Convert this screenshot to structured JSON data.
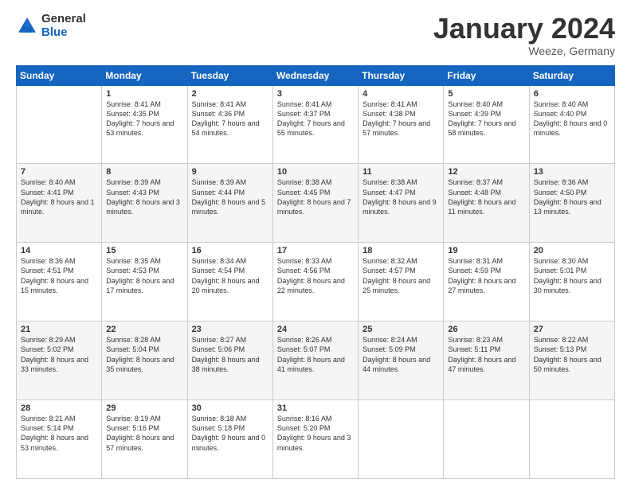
{
  "logo": {
    "general": "General",
    "blue": "Blue"
  },
  "header": {
    "month": "January 2024",
    "location": "Weeze, Germany"
  },
  "weekdays": [
    "Sunday",
    "Monday",
    "Tuesday",
    "Wednesday",
    "Thursday",
    "Friday",
    "Saturday"
  ],
  "weeks": [
    [
      {
        "day": "",
        "sunrise": "",
        "sunset": "",
        "daylight": ""
      },
      {
        "day": "1",
        "sunrise": "Sunrise: 8:41 AM",
        "sunset": "Sunset: 4:35 PM",
        "daylight": "Daylight: 7 hours and 53 minutes."
      },
      {
        "day": "2",
        "sunrise": "Sunrise: 8:41 AM",
        "sunset": "Sunset: 4:36 PM",
        "daylight": "Daylight: 7 hours and 54 minutes."
      },
      {
        "day": "3",
        "sunrise": "Sunrise: 8:41 AM",
        "sunset": "Sunset: 4:37 PM",
        "daylight": "Daylight: 7 hours and 55 minutes."
      },
      {
        "day": "4",
        "sunrise": "Sunrise: 8:41 AM",
        "sunset": "Sunset: 4:38 PM",
        "daylight": "Daylight: 7 hours and 57 minutes."
      },
      {
        "day": "5",
        "sunrise": "Sunrise: 8:40 AM",
        "sunset": "Sunset: 4:39 PM",
        "daylight": "Daylight: 7 hours and 58 minutes."
      },
      {
        "day": "6",
        "sunrise": "Sunrise: 8:40 AM",
        "sunset": "Sunset: 4:40 PM",
        "daylight": "Daylight: 8 hours and 0 minutes."
      }
    ],
    [
      {
        "day": "7",
        "sunrise": "Sunrise: 8:40 AM",
        "sunset": "Sunset: 4:41 PM",
        "daylight": "Daylight: 8 hours and 1 minute."
      },
      {
        "day": "8",
        "sunrise": "Sunrise: 8:39 AM",
        "sunset": "Sunset: 4:43 PM",
        "daylight": "Daylight: 8 hours and 3 minutes."
      },
      {
        "day": "9",
        "sunrise": "Sunrise: 8:39 AM",
        "sunset": "Sunset: 4:44 PM",
        "daylight": "Daylight: 8 hours and 5 minutes."
      },
      {
        "day": "10",
        "sunrise": "Sunrise: 8:38 AM",
        "sunset": "Sunset: 4:45 PM",
        "daylight": "Daylight: 8 hours and 7 minutes."
      },
      {
        "day": "11",
        "sunrise": "Sunrise: 8:38 AM",
        "sunset": "Sunset: 4:47 PM",
        "daylight": "Daylight: 8 hours and 9 minutes."
      },
      {
        "day": "12",
        "sunrise": "Sunrise: 8:37 AM",
        "sunset": "Sunset: 4:48 PM",
        "daylight": "Daylight: 8 hours and 11 minutes."
      },
      {
        "day": "13",
        "sunrise": "Sunrise: 8:36 AM",
        "sunset": "Sunset: 4:50 PM",
        "daylight": "Daylight: 8 hours and 13 minutes."
      }
    ],
    [
      {
        "day": "14",
        "sunrise": "Sunrise: 8:36 AM",
        "sunset": "Sunset: 4:51 PM",
        "daylight": "Daylight: 8 hours and 15 minutes."
      },
      {
        "day": "15",
        "sunrise": "Sunrise: 8:35 AM",
        "sunset": "Sunset: 4:53 PM",
        "daylight": "Daylight: 8 hours and 17 minutes."
      },
      {
        "day": "16",
        "sunrise": "Sunrise: 8:34 AM",
        "sunset": "Sunset: 4:54 PM",
        "daylight": "Daylight: 8 hours and 20 minutes."
      },
      {
        "day": "17",
        "sunrise": "Sunrise: 8:33 AM",
        "sunset": "Sunset: 4:56 PM",
        "daylight": "Daylight: 8 hours and 22 minutes."
      },
      {
        "day": "18",
        "sunrise": "Sunrise: 8:32 AM",
        "sunset": "Sunset: 4:57 PM",
        "daylight": "Daylight: 8 hours and 25 minutes."
      },
      {
        "day": "19",
        "sunrise": "Sunrise: 8:31 AM",
        "sunset": "Sunset: 4:59 PM",
        "daylight": "Daylight: 8 hours and 27 minutes."
      },
      {
        "day": "20",
        "sunrise": "Sunrise: 8:30 AM",
        "sunset": "Sunset: 5:01 PM",
        "daylight": "Daylight: 8 hours and 30 minutes."
      }
    ],
    [
      {
        "day": "21",
        "sunrise": "Sunrise: 8:29 AM",
        "sunset": "Sunset: 5:02 PM",
        "daylight": "Daylight: 8 hours and 33 minutes."
      },
      {
        "day": "22",
        "sunrise": "Sunrise: 8:28 AM",
        "sunset": "Sunset: 5:04 PM",
        "daylight": "Daylight: 8 hours and 35 minutes."
      },
      {
        "day": "23",
        "sunrise": "Sunrise: 8:27 AM",
        "sunset": "Sunset: 5:06 PM",
        "daylight": "Daylight: 8 hours and 38 minutes."
      },
      {
        "day": "24",
        "sunrise": "Sunrise: 8:26 AM",
        "sunset": "Sunset: 5:07 PM",
        "daylight": "Daylight: 8 hours and 41 minutes."
      },
      {
        "day": "25",
        "sunrise": "Sunrise: 8:24 AM",
        "sunset": "Sunset: 5:09 PM",
        "daylight": "Daylight: 8 hours and 44 minutes."
      },
      {
        "day": "26",
        "sunrise": "Sunrise: 8:23 AM",
        "sunset": "Sunset: 5:11 PM",
        "daylight": "Daylight: 8 hours and 47 minutes."
      },
      {
        "day": "27",
        "sunrise": "Sunrise: 8:22 AM",
        "sunset": "Sunset: 5:13 PM",
        "daylight": "Daylight: 8 hours and 50 minutes."
      }
    ],
    [
      {
        "day": "28",
        "sunrise": "Sunrise: 8:21 AM",
        "sunset": "Sunset: 5:14 PM",
        "daylight": "Daylight: 8 hours and 53 minutes."
      },
      {
        "day": "29",
        "sunrise": "Sunrise: 8:19 AM",
        "sunset": "Sunset: 5:16 PM",
        "daylight": "Daylight: 8 hours and 57 minutes."
      },
      {
        "day": "30",
        "sunrise": "Sunrise: 8:18 AM",
        "sunset": "Sunset: 5:18 PM",
        "daylight": "Daylight: 9 hours and 0 minutes."
      },
      {
        "day": "31",
        "sunrise": "Sunrise: 8:16 AM",
        "sunset": "Sunset: 5:20 PM",
        "daylight": "Daylight: 9 hours and 3 minutes."
      },
      {
        "day": "",
        "sunrise": "",
        "sunset": "",
        "daylight": ""
      },
      {
        "day": "",
        "sunrise": "",
        "sunset": "",
        "daylight": ""
      },
      {
        "day": "",
        "sunrise": "",
        "sunset": "",
        "daylight": ""
      }
    ]
  ]
}
